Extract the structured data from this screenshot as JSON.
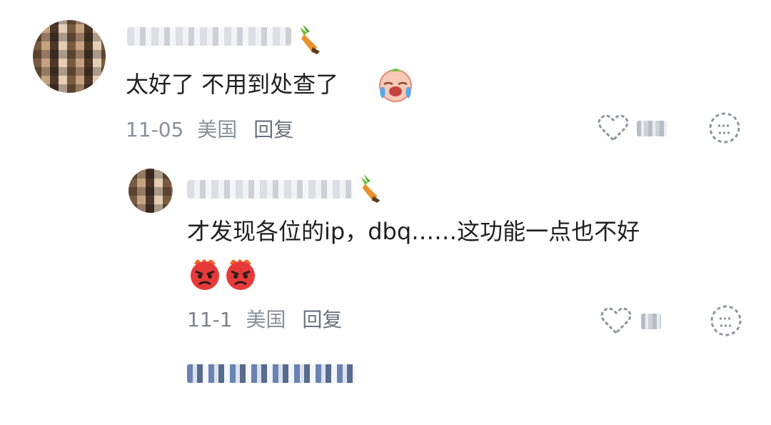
{
  "comment": {
    "text": "太好了 不用到处查了",
    "date": "11-05",
    "location": "美国",
    "reply_label": "回复",
    "like_count": "26"
  },
  "reply": {
    "text_line1": "才发现各位的ip，dbq……这功能一点也不好",
    "date": "11-1",
    "location": "美国",
    "reply_label": "回复",
    "like_count": "3"
  },
  "icons": {
    "like": "heart-icon",
    "dislike": "dislike-face-icon",
    "badge": "carrot-badge-icon",
    "emoji_cry": "crying-face-emoji",
    "emoji_angry": "angry-face-emoji"
  },
  "colors": {
    "text": "#1f1f1f",
    "meta": "#8a8f99",
    "link": "#2a4a8a"
  }
}
